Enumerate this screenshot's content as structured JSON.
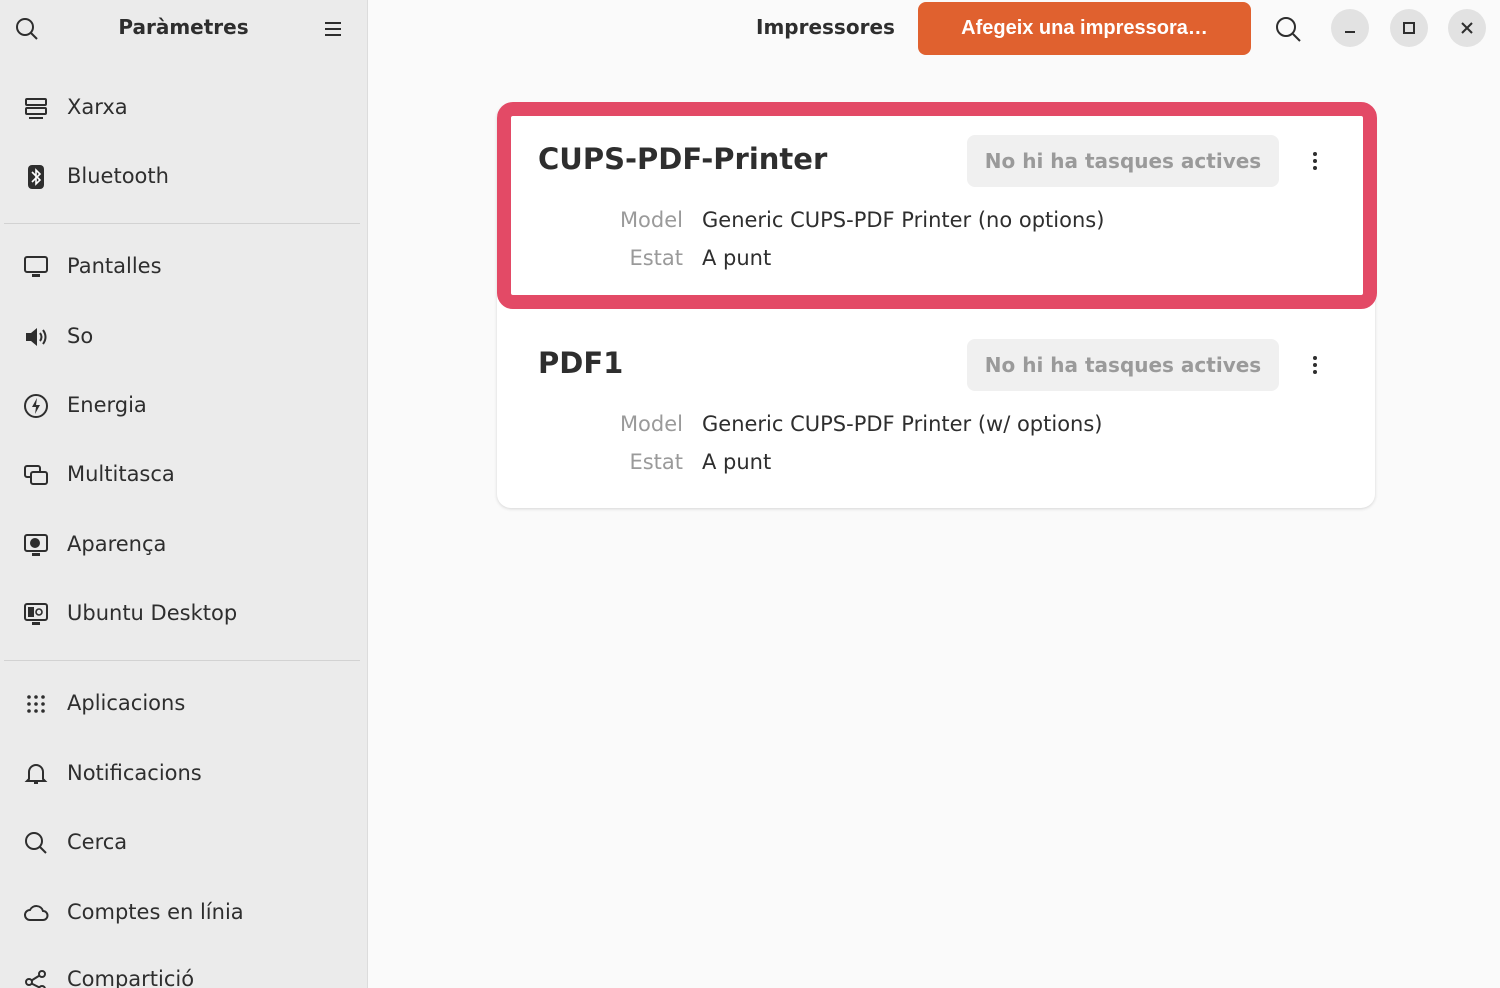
{
  "sidebar": {
    "title": "Paràmetres",
    "items": [
      {
        "label": "Xarxa",
        "icon": "network-icon"
      },
      {
        "label": "Bluetooth",
        "icon": "bluetooth-icon"
      },
      {
        "label": "Pantalles",
        "icon": "display-icon"
      },
      {
        "label": "So",
        "icon": "speaker-icon"
      },
      {
        "label": "Energia",
        "icon": "power-icon"
      },
      {
        "label": "Multitasca",
        "icon": "multitasking-icon"
      },
      {
        "label": "Aparença",
        "icon": "appearance-icon"
      },
      {
        "label": "Ubuntu Desktop",
        "icon": "ubuntu-desktop-icon"
      },
      {
        "label": "Aplicacions",
        "icon": "apps-grid-icon"
      },
      {
        "label": "Notificacions",
        "icon": "bell-icon"
      },
      {
        "label": "Cerca",
        "icon": "search-icon"
      },
      {
        "label": "Comptes en línia",
        "icon": "cloud-icon"
      },
      {
        "label": "Compartició",
        "icon": "share-icon"
      }
    ]
  },
  "header": {
    "title": "Impressores",
    "add_button": "Afegeix una impressora…"
  },
  "printers": [
    {
      "name": "CUPS-PDF-Printer",
      "jobs": "No hi ha tasques actives",
      "model_label": "Model",
      "model": "Generic CUPS-PDF Printer (no options)",
      "state_label": "Estat",
      "state": "A punt"
    },
    {
      "name": "PDF1",
      "jobs": "No hi ha tasques actives",
      "model_label": "Model",
      "model": "Generic CUPS-PDF Printer (w/ options)",
      "state_label": "Estat",
      "state": "A punt"
    }
  ],
  "colors": {
    "accent": "#e0612f",
    "highlight": "#e34a66"
  }
}
